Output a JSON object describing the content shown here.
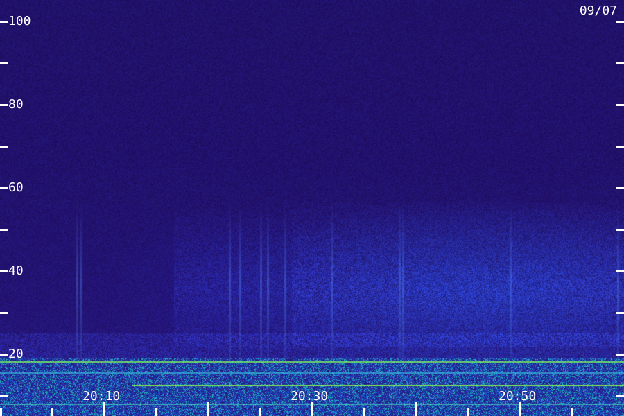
{
  "date": "09/07",
  "y_axis": {
    "labels": [
      "100",
      "80",
      "60",
      "40",
      "20"
    ],
    "tick_values": [
      100,
      90,
      80,
      70,
      60,
      50,
      40,
      30,
      20,
      10
    ]
  },
  "x_axis": {
    "labels": [
      "20:10",
      "20:30",
      "20:50"
    ]
  },
  "colors": {
    "background": "#1e0c55",
    "band_low": "#1bd0c0",
    "band_line": "#7cff4a",
    "label": "#ffffff"
  }
}
